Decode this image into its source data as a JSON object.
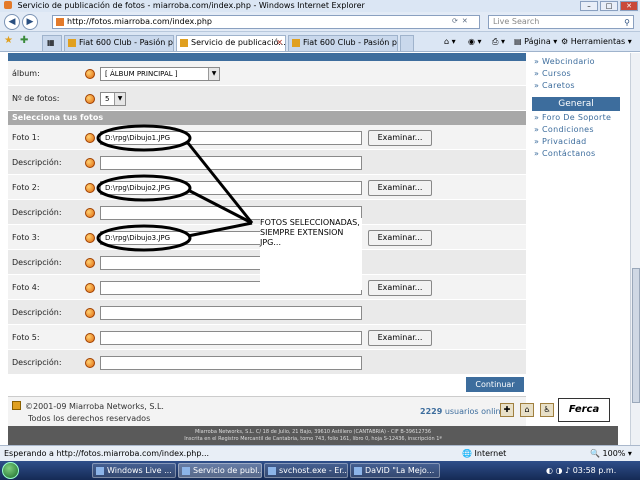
{
  "browser": {
    "window_title": "Servicio de publicación de fotos - miarroba.com/index.php - Windows Internet Explorer",
    "url": "http://fotos.miarroba.com/index.php",
    "search_placeholder": "Live Search",
    "tabs": [
      {
        "label": "Fiat 600 Club - Pasión por ..."
      },
      {
        "label": "Servicio de publicació..."
      },
      {
        "label": "Fiat 600 Club - Pasión por ..."
      }
    ],
    "toolbar_page": "Página",
    "toolbar_tools": "Herramientas",
    "status_text": "Esperando a http://fotos.miarroba.com/index.php...",
    "zone_text": "Internet",
    "zoom_text": "100%"
  },
  "form": {
    "album_label": "álbum:",
    "album_value": "[ ÁLBUM PRINCIPAL ]",
    "num_label": "Nº de fotos:",
    "num_value": "5",
    "section_title": "Selecciona tus fotos",
    "browse_label": "Examinar...",
    "desc_label": "Descripción:",
    "photos": [
      {
        "label": "Foto 1:",
        "value": "D:\\rpg\\Dibujo1.JPG"
      },
      {
        "label": "Foto 2:",
        "value": "D:\\rpg\\Dibujo2.JPG"
      },
      {
        "label": "Foto 3:",
        "value": "D:\\rpg\\Dibujo3.JPG"
      },
      {
        "label": "Foto 4:",
        "value": ""
      },
      {
        "label": "Foto 5:",
        "value": ""
      }
    ],
    "submit_label": "Continuar"
  },
  "sidebar": {
    "links_top": [
      "Webcindario",
      "Cursos",
      "Caretos"
    ],
    "header": "General",
    "links_general": [
      "Foro De Soporte",
      "Condiciones",
      "Privacidad",
      "Contáctanos"
    ]
  },
  "annotation": {
    "text": "FOTOS SELECCIONADAS, SIEMPRE EXTENSION JPG..."
  },
  "footer": {
    "copyright": "©2001-09 Miarroba Networks, S.L.",
    "rights": "Todos los derechos reservados",
    "users_count": "2229",
    "users_label": "usuarios online",
    "host_logo": "Ferca",
    "legal_line1": "Miarroba Networks, S.L. C/ 18 de Julio, 21 Bajo, 39610 Astillero (CANTABRIA) - CIF B-39612736",
    "legal_line2": "Inscrita en el Registro Mercantil de Cantabria, tomo 743, folio 161, libro 0, hoja S-12436, inscripción 1ª"
  },
  "taskbar": {
    "items": [
      "Windows Live ...",
      "Servicio de publ...",
      "svchost.exe - Er...",
      "DaViD \"La Mejo..."
    ],
    "clock": "03:58 p.m."
  },
  "colors": {
    "brand_blue": "#3d6d9d",
    "section_gray": "#a8a8a8",
    "row_gray": "#f3f3f3"
  }
}
